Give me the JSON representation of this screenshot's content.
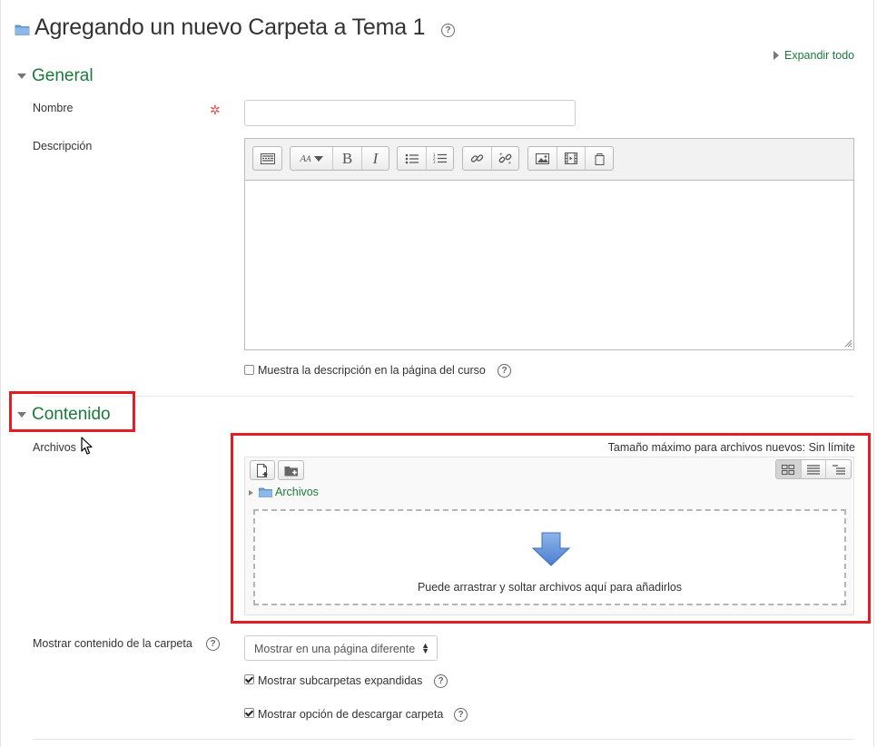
{
  "page": {
    "title": "Agregando un nuevo Carpeta a Tema 1",
    "expand_all": "Expandir todo"
  },
  "general": {
    "section_title": "General",
    "name_label": "Nombre",
    "name_value": "",
    "description_label": "Descripción",
    "toolbar": [
      {
        "group": "toolbar-toggle",
        "buttons": [
          "toolbar-toggle-icon"
        ]
      },
      {
        "group": "text-style",
        "buttons": [
          "font-style-icon",
          "bold-icon",
          "italic-icon"
        ]
      },
      {
        "group": "lists",
        "buttons": [
          "unordered-list-icon",
          "ordered-list-icon"
        ]
      },
      {
        "group": "links",
        "buttons": [
          "link-icon",
          "unlink-icon"
        ]
      },
      {
        "group": "media",
        "buttons": [
          "image-icon",
          "media-icon",
          "manage-files-icon"
        ]
      }
    ],
    "bold_glyph": "B",
    "italic_glyph": "I",
    "show_description_label": "Muestra la descripción en la página del curso",
    "show_description_checked": false
  },
  "content": {
    "section_title": "Contenido",
    "files_label": "Archivos",
    "max_size_text": "Tamaño máximo para archivos nuevos: Sin límite",
    "path_folder": "Archivos",
    "drop_text": "Puede arrastrar y soltar archivos aquí para añadirlos",
    "display_label": "Mostrar contenido de la carpeta",
    "display_value": "Mostrar en una página diferente",
    "subfolders_label": "Mostrar subcarpetas expandidas",
    "subfolders_checked": true,
    "download_label": "Mostrar opción de descargar carpeta",
    "download_checked": true
  },
  "colors": {
    "accent_green": "#1b7a3a",
    "highlight_red": "#e41c23",
    "required_red": "#d9534f",
    "folder_blue": "#6b9fd8"
  }
}
